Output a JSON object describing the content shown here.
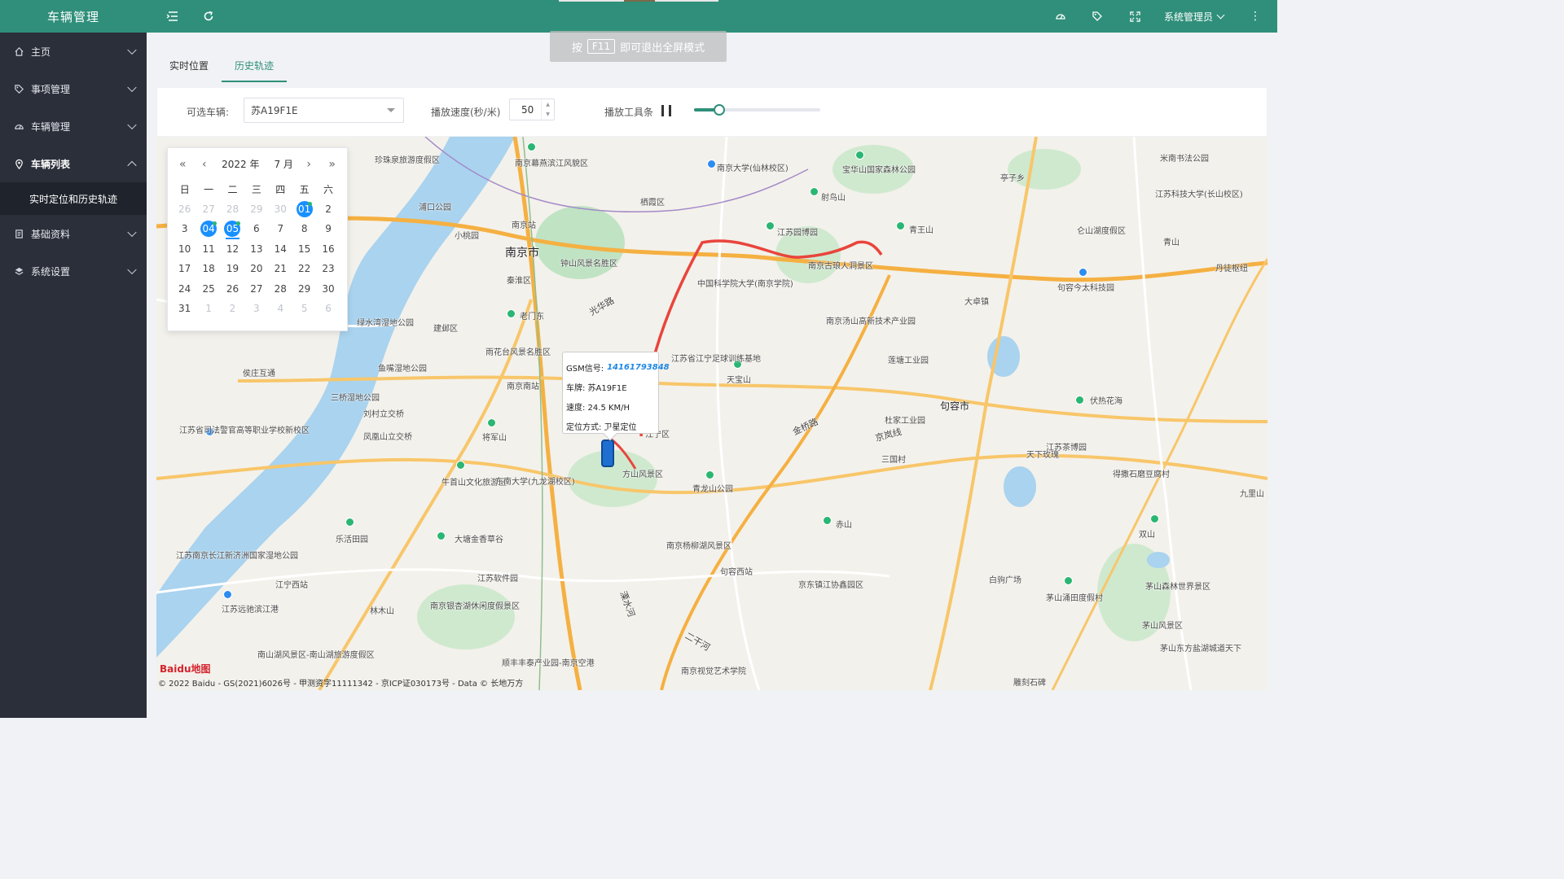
{
  "app": {
    "title": "车辆管理"
  },
  "sidebar": {
    "items": [
      {
        "label": "主页",
        "icon": "home-icon"
      },
      {
        "label": "事项管理",
        "icon": "tag-icon"
      },
      {
        "label": "车辆管理",
        "icon": "dashboard-icon"
      },
      {
        "label": "车辆列表",
        "icon": "location-icon",
        "open": true
      },
      {
        "label": "基础资料",
        "icon": "document-icon"
      },
      {
        "label": "系统设置",
        "icon": "layers-icon"
      }
    ],
    "submenu": [
      {
        "label": "实时定位和历史轨迹"
      }
    ]
  },
  "topbar": {
    "user": "系统管理员",
    "icons": [
      "menu-icon",
      "refresh-icon",
      "palette-icon",
      "tag-icon",
      "fullscreen-icon",
      "more-icon"
    ]
  },
  "toast": {
    "pre": "按",
    "key": "F11",
    "post": "即可退出全屏模式"
  },
  "tabs": [
    {
      "label": "实时位置"
    },
    {
      "label": "历史轨迹",
      "active": true
    }
  ],
  "controls": {
    "vehicle_label": "可选车辆:",
    "vehicle_value": "苏A19F1E",
    "speed_label": "播放速度(秒/米)",
    "speed_value": "50",
    "toolbar_label": "播放工具条",
    "progress": 0.2
  },
  "calendar": {
    "year": "2022 年",
    "month": "7 月",
    "weekdays": [
      "日",
      "一",
      "二",
      "三",
      "四",
      "五",
      "六"
    ],
    "rows": [
      [
        "26",
        "27",
        "28",
        "29",
        "30",
        "01",
        "2"
      ],
      [
        "3",
        "04",
        "05",
        "6",
        "7",
        "8",
        "9"
      ],
      [
        "10",
        "11",
        "12",
        "13",
        "14",
        "15",
        "16"
      ],
      [
        "17",
        "18",
        "19",
        "20",
        "21",
        "22",
        "23"
      ],
      [
        "24",
        "25",
        "26",
        "27",
        "28",
        "29",
        "30"
      ],
      [
        "31",
        "1",
        "2",
        "3",
        "4",
        "5",
        "6"
      ]
    ]
  },
  "popup": {
    "gsm_label": "GSM信号:",
    "gsm_value": "14161793848",
    "plate": "车牌: 苏A19F1E",
    "speed": "速度: 24.5 KM/H",
    "locate": "定位方式: 卫星定位"
  },
  "map": {
    "city": "南京市",
    "labels": [
      "珍珠泉旅游度假区",
      "南京幕燕滨江风貌区",
      "南京大学(仙林校区)",
      "宝华山国家森林公园",
      "米南书法公园",
      "浦口公园",
      "栖霞区",
      "亭子乡",
      "江苏科技大学(长山校区)",
      "南京站",
      "射鸟山",
      "小桃园",
      "钟山风景名胜区",
      "江苏园博园",
      "青王山",
      "仑山湖度假区",
      "青山",
      "秦淮区",
      "中国科学院大学(南京学院)",
      "南京古琅人洞景区",
      "句容今太科技园",
      "丹徒枢纽",
      "光华路",
      "老门东",
      "南京汤山高新技术产业园",
      "大卓镇",
      "建邺区",
      "绿水湾湿地公园",
      "雨花台风景名胜区",
      "江苏省江宁足球训练基地",
      "莲塘工业园",
      "鱼嘴湿地公园",
      "天宝山",
      "句容市",
      "伏热花海",
      "侯庄互通",
      "三桥湿地公园",
      "南京南站",
      "刘村立交桥",
      "金桥路",
      "京岚线",
      "杜家工业园",
      "天下玫瑰",
      "江苏茶博园",
      "江苏省司法警官高等职业学校新校区",
      "凤凰山立交桥",
      "将军山",
      "江宁区",
      "方山风景区",
      "三国村",
      "得撒石磨豆腐村",
      "九里山",
      "牛首山文化旅游区",
      "东南大学(九龙湖校区)",
      "青龙山公园",
      "赤山",
      "双山",
      "乐活田园",
      "大塘金香草谷",
      "南京杨柳湖风景区",
      "江苏南京长江新济洲国家湿地公园",
      "句容西站",
      "白驹广场",
      "茅山森林世界景区",
      "江宁西站",
      "江苏软件园",
      "京东镇江协鑫园区",
      "茅山涌田度假村",
      "江苏远驰滨江港",
      "南京银杏湖休闲度假景区",
      "林木山",
      "茅山风景区",
      "茅山东方盐湖城道天下",
      "南山湖风景区-南山湖旅游度假区",
      "顺丰丰泰产业园-南京空港",
      "南京视觉艺术学院",
      "雕刻石碑",
      "溧水河",
      "二干河"
    ],
    "copyright": "© 2022 Baidu - GS(2021)6026号 - 甲测资字11111342 - 京ICP证030173号 - Data © 长地万方",
    "logo": "Baidu地图"
  }
}
